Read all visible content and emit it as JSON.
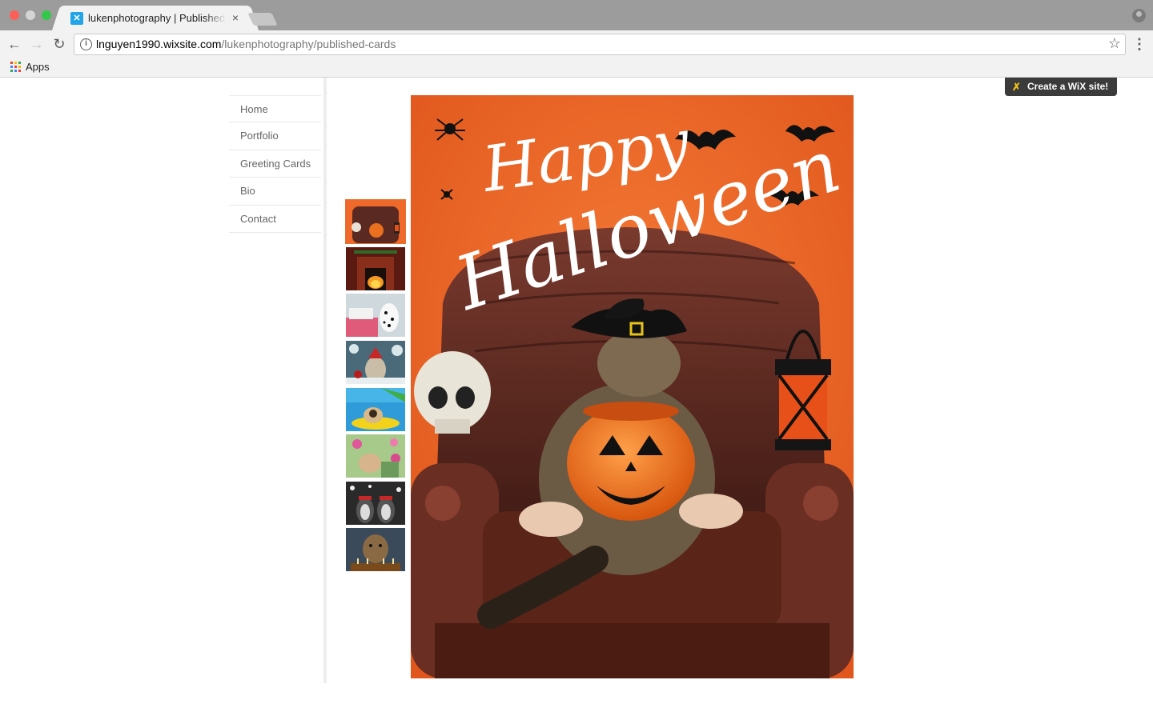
{
  "browser": {
    "tab_title": "lukenphotography | Published Cards",
    "tab_close": "×",
    "url_host": "lnguyen1990.wixsite.com",
    "url_path": "/lukenphotography/published-cards",
    "bookmarks": [
      {
        "label": "Apps"
      }
    ]
  },
  "site": {
    "wix_banner": "Create a WiX site!",
    "nav": [
      {
        "label": "Home"
      },
      {
        "label": "Portfolio"
      },
      {
        "label": "Greeting Cards"
      },
      {
        "label": "Bio"
      },
      {
        "label": "Contact"
      }
    ],
    "card_title_art": [
      "Happy",
      "Halloween"
    ],
    "thumbnails": [
      {
        "name": "halloween-cat",
        "selected": true
      },
      {
        "name": "fireplace",
        "selected": false
      },
      {
        "name": "dalmatian",
        "selected": false
      },
      {
        "name": "christmas-cat",
        "selected": false
      },
      {
        "name": "pug-pool",
        "selected": false
      },
      {
        "name": "flowers-dog",
        "selected": false
      },
      {
        "name": "penguins",
        "selected": false
      },
      {
        "name": "birthday-cat",
        "selected": false
      }
    ]
  },
  "colors": {
    "card_orange": "#ef6a2a",
    "leather": "#5a2a22",
    "selected_outline": "#e6702f"
  },
  "icons": {
    "apps": "apps-grid-icon",
    "star": "bookmark-star-icon",
    "menu": "kebab-menu-icon"
  }
}
